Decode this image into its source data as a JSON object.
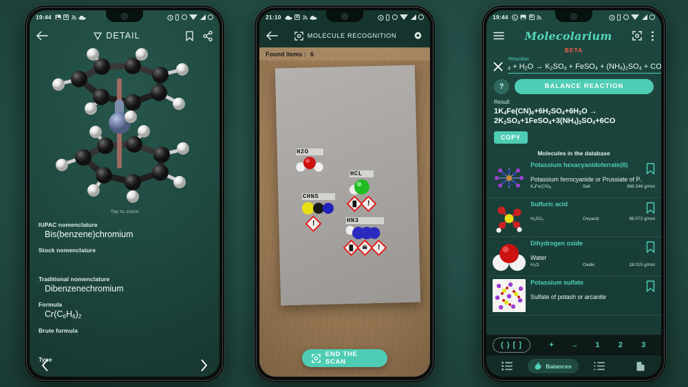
{
  "phones": {
    "left": {
      "status": {
        "time": "19:44",
        "left_icons": [
          "image-icon",
          "bluetooth-badge-icon",
          "rss-icon",
          "cloud-icon"
        ],
        "right_icons": [
          "alarm-icon",
          "sim-icon",
          "do-not-disturb-icon",
          "wifi-icon",
          "signal-icon",
          "battery-icon"
        ]
      },
      "appbar": {
        "title": "DETAIL",
        "leading_icon": "back-arrow-icon",
        "title_icon": "triangle-down-icon",
        "actions": [
          "bookmark-icon",
          "share-icon"
        ]
      },
      "viewer": {
        "hint": "Tap to zoom",
        "molecule": "Bis(benzene)chromium 3D model"
      },
      "fields": [
        {
          "label": "IUPAC nomenclature",
          "value": "Bis(benzene)chromium"
        },
        {
          "label": "Stock nomenclature",
          "value": ""
        },
        {
          "label": "Traditional nomenclature",
          "value": "Dibenzenechromium"
        },
        {
          "label": "Formula",
          "value": "Cr(C6H6)2",
          "value_html": "Cr(C<sub>6</sub>H<sub>6</sub>)<sub>2</sub>"
        },
        {
          "label": "Brute formula",
          "value": ""
        },
        {
          "label": "Type",
          "value": ""
        }
      ],
      "nav": {
        "prev": "chevron-left-icon",
        "next": "chevron-right-icon"
      }
    },
    "middle": {
      "status": {
        "time": "21:10",
        "left_icons": [
          "cloud-icon",
          "bluetooth-badge-icon",
          "rss-icon",
          "cloud-icon"
        ],
        "right_icons": [
          "alarm-icon",
          "sim-icon",
          "do-not-disturb-icon",
          "wifi-icon",
          "signal-icon",
          "battery-icon"
        ]
      },
      "appbar": {
        "title": "MOLECULE RECOGNITION",
        "leading_icon": "back-arrow-icon",
        "title_icon": "scan-frame-icon",
        "actions": [
          "gear-icon"
        ]
      },
      "found_items_label": "Found items :",
      "found_items_count": "6",
      "markers": [
        {
          "label": "H2O",
          "hazards": []
        },
        {
          "label": "CHNS",
          "hazards": [
            "exclamation-mark"
          ]
        },
        {
          "label": "HCL",
          "hazards": [
            "corrosion",
            "exclamation-mark"
          ]
        },
        {
          "label": "HN3",
          "hazards": [
            "corrosion",
            "toxic-skull",
            "exclamation-mark"
          ]
        }
      ],
      "end_scan_label": "END THE SCAN",
      "end_scan_icon": "scan-frame-icon"
    },
    "right": {
      "status": {
        "time": "19:44",
        "left_icons": [
          "whatsapp-icon",
          "image-icon",
          "bluetooth-badge-icon",
          "rss-icon"
        ],
        "right_icons": [
          "alarm-icon",
          "sim-icon",
          "do-not-disturb-icon",
          "wifi-icon",
          "signal-icon",
          "battery-icon"
        ]
      },
      "appbar": {
        "brand": "Molecolarium",
        "leading_icon": "hamburger-menu-icon",
        "actions": [
          "scan-frame-icon",
          "overflow-menu-icon"
        ]
      },
      "beta_badge": "BETA",
      "reaction": {
        "field_label": "Reaction",
        "clear_icon": "close-icon",
        "value": "4 + H2O → K2SO4 + FeSO4 + (NH4)2SO4 + CO",
        "value_html": "<sub>4</sub> + H<sub>2</sub>O &#8594; K<sub>2</sub>SO<sub>4</sub> + FeSO<sub>4</sub> + (NH<sub>4</sub>)<sub>2</sub>SO<sub>4</sub> + CO"
      },
      "help_button": "?",
      "balance_button": "BALANCE REACTION",
      "result_label": "Result",
      "result_line1": "1K4Fe(CN)6+6H2SO4+6H2O →",
      "result_line1_html": "1K<sub>4</sub>Fe(CN)<sub>6</sub>+6H<sub>2</sub>SO<sub>4</sub>+6H<sub>2</sub>O &#8594;",
      "result_line2": "2K2SO4+1FeSO4+3(NH4)2SO4+6CO",
      "result_line2_html": "2K<sub>2</sub>SO<sub>4</sub>+1FeSO<sub>4</sub>+3(NH<sub>4</sub>)<sub>2</sub>SO<sub>4</sub>+6CO",
      "copy_button": "COPY",
      "database_title": "Molecules in the database",
      "molecules": [
        {
          "name": "Potassium hexacyanidoferrate(II)",
          "common": "Potassium ferrocyanide or Prussiate of P..",
          "formula": "K4Fe(CN)6",
          "formula_html": "K<sub>4</sub>Fe(CN)<sub>6</sub>",
          "category": "Salt",
          "mass": "368.346 g/mol",
          "bookmark": "bookmark-icon"
        },
        {
          "name": "Sulfuric acid",
          "common": "",
          "formula": "H2SO4",
          "formula_html": "H<sub>2</sub>SO<sub>4</sub>",
          "category": "Oxyacid",
          "mass": "98.072 g/mol",
          "bookmark": "bookmark-icon"
        },
        {
          "name": "Dihydrogen oxide",
          "common": "Water",
          "formula": "H2O",
          "formula_html": "H<sub>2</sub>O",
          "category": "Oxide",
          "mass": "18.015 g/mol",
          "bookmark": "bookmark-icon"
        },
        {
          "name": "Potassium sulfate",
          "common": "Sulfate of potash or arcanite",
          "formula": "",
          "formula_html": "",
          "category": "",
          "mass": "",
          "bookmark": "bookmark-icon"
        }
      ],
      "keyboard": {
        "paren_key": "( ) [ ]",
        "keys": [
          "+",
          "→",
          "1",
          "2",
          "3"
        ]
      },
      "bottom_nav": [
        {
          "label": "",
          "icon": "list-icon",
          "active": false
        },
        {
          "label": "Balances",
          "icon": "flame-icon",
          "active": true
        },
        {
          "label": "",
          "icon": "ordered-list-icon",
          "active": false
        },
        {
          "label": "",
          "icon": "book-icon",
          "active": false
        }
      ]
    }
  },
  "colors": {
    "accent": "#4ecdb4",
    "accent_text": "#4fd0b6",
    "beta": "#ff5a4d",
    "background": "#24544a",
    "hazard_red": "#e01b1b"
  }
}
